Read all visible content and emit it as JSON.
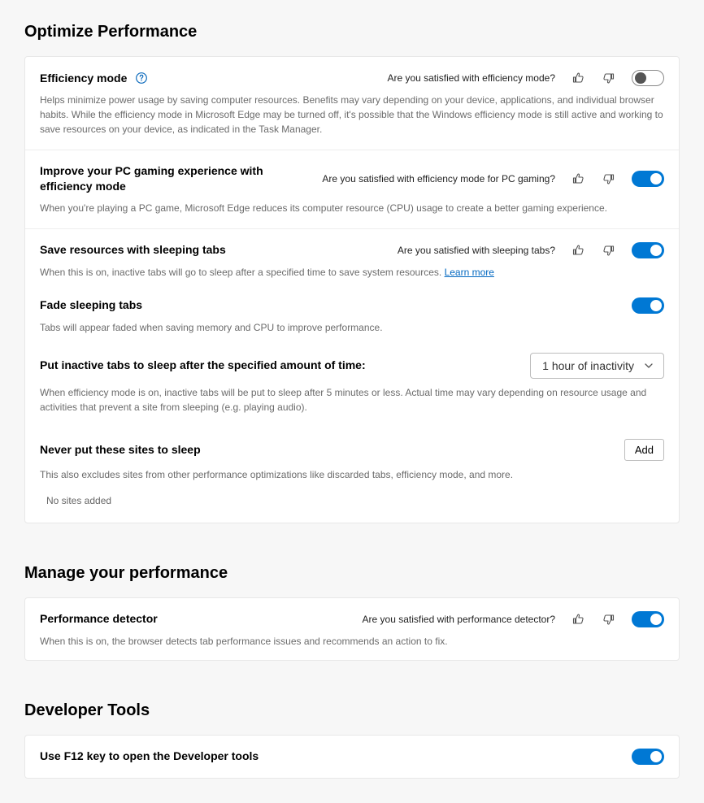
{
  "sections": {
    "optimize": {
      "heading": "Optimize Performance",
      "efficiency": {
        "title": "Efficiency mode",
        "feedback_q": "Are you satisfied with efficiency mode?",
        "toggle_on": false,
        "desc": "Helps minimize power usage by saving computer resources. Benefits may vary depending on your device, applications, and individual browser habits. While the efficiency mode in Microsoft Edge may be turned off, it's possible that the Windows efficiency mode is still active and working to save resources on your device, as indicated in the Task Manager."
      },
      "gaming": {
        "title": "Improve your PC gaming experience with efficiency mode",
        "feedback_q": "Are you satisfied with efficiency mode for PC gaming?",
        "toggle_on": true,
        "desc": "When you're playing a PC game, Microsoft Edge reduces its computer resource (CPU) usage to create a better gaming experience."
      },
      "sleeping": {
        "title": "Save resources with sleeping tabs",
        "feedback_q": "Are you satisfied with sleeping tabs?",
        "toggle_on": true,
        "desc_pre": "When this is on, inactive tabs will go to sleep after a specified time to save system resources. ",
        "learn_more": "Learn more"
      },
      "fade": {
        "title": "Fade sleeping tabs",
        "toggle_on": true,
        "desc": "Tabs will appear faded when saving memory and CPU to improve performance."
      },
      "inactive_time": {
        "title": "Put inactive tabs to sleep after the specified amount of time:",
        "selected": "1 hour of inactivity",
        "desc": "When efficiency mode is on, inactive tabs will be put to sleep after 5 minutes or less. Actual time may vary depending on resource usage and activities that prevent a site from sleeping (e.g. playing audio)."
      },
      "never_sleep": {
        "title": "Never put these sites to sleep",
        "add_label": "Add",
        "desc": "This also excludes sites from other performance optimizations like discarded tabs, efficiency mode, and more.",
        "empty": "No sites added"
      }
    },
    "manage": {
      "heading": "Manage your performance",
      "detector": {
        "title": "Performance detector",
        "feedback_q": "Are you satisfied with performance detector?",
        "toggle_on": true,
        "desc": "When this is on, the browser detects tab performance issues and recommends an action to fix."
      }
    },
    "devtools": {
      "heading": "Developer Tools",
      "f12": {
        "title": "Use F12 key to open the Developer tools",
        "toggle_on": true
      }
    }
  }
}
